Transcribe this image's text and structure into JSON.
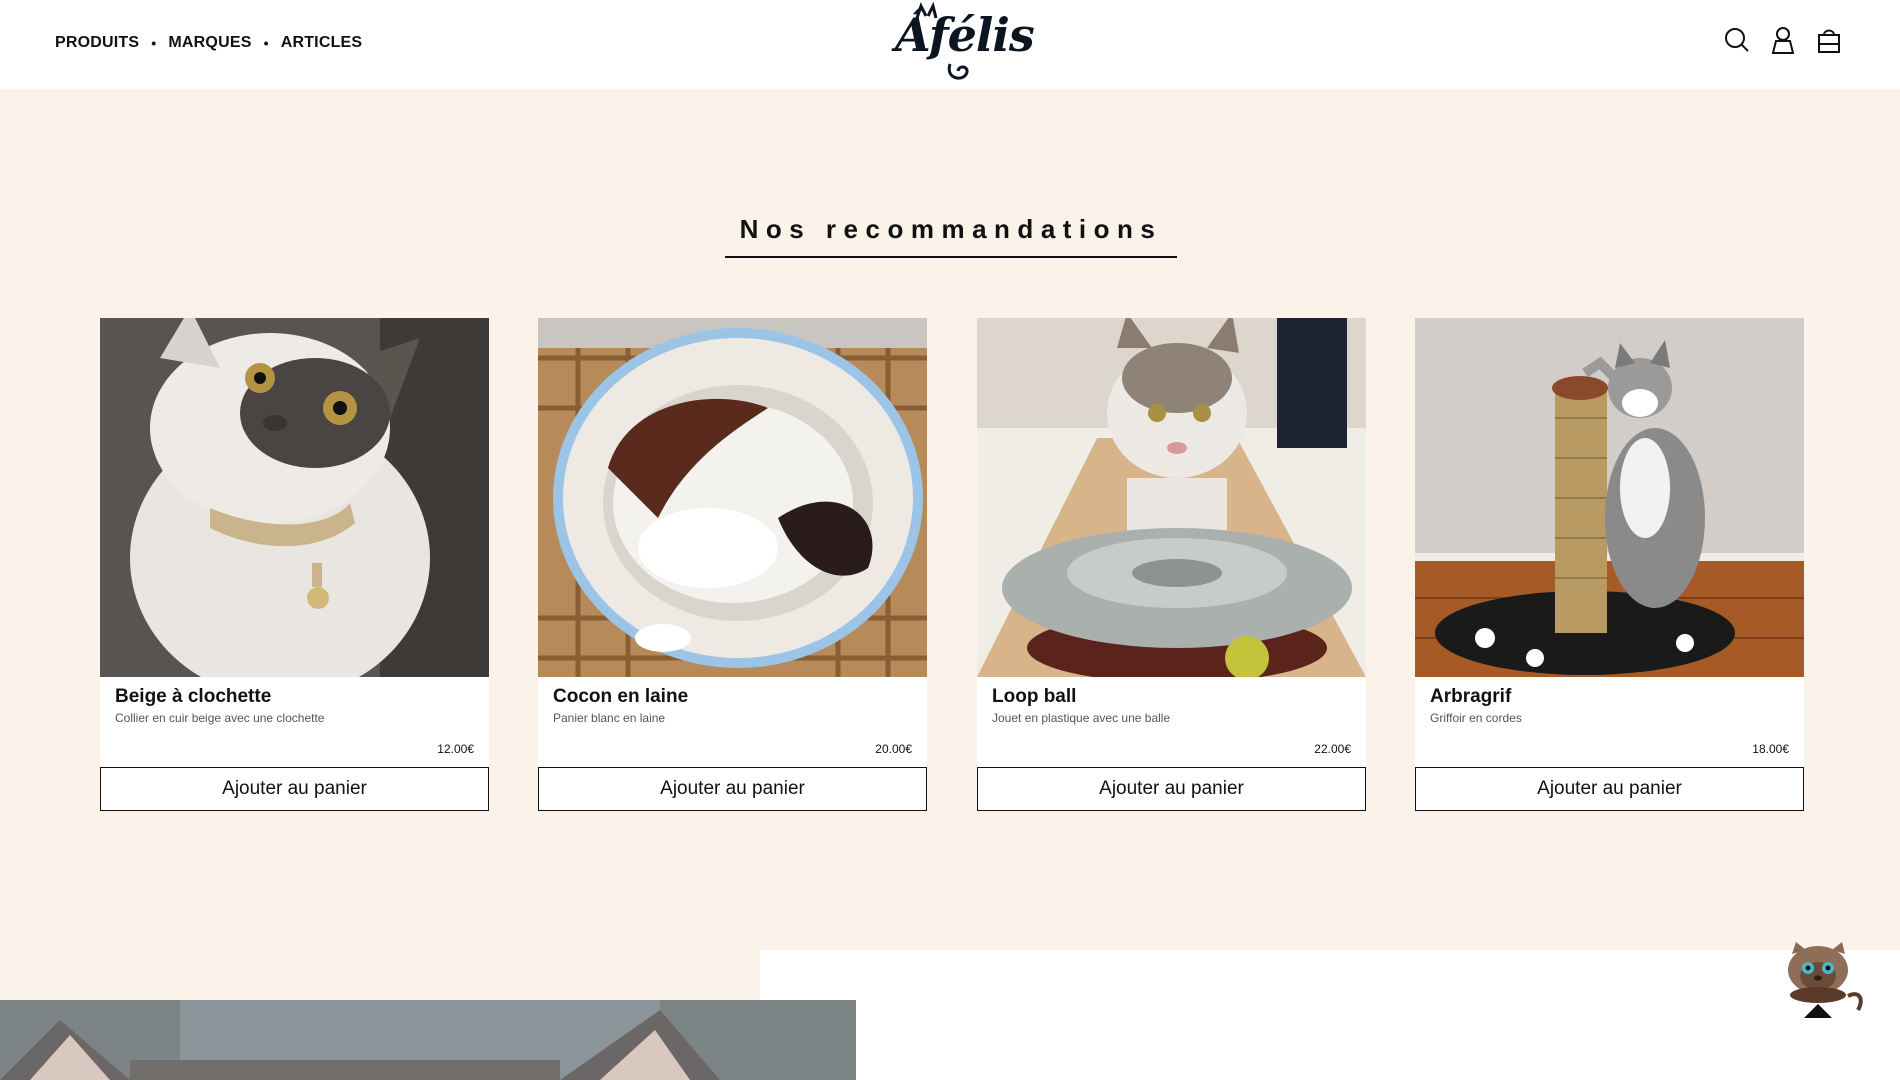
{
  "header": {
    "nav": [
      {
        "label": "PRODUITS"
      },
      {
        "label": "MARQUES"
      },
      {
        "label": "ARTICLES"
      }
    ],
    "nav_separator": "•",
    "logo_text": "Áfélis",
    "icons": [
      "search-icon",
      "user-icon",
      "cart-icon"
    ]
  },
  "recommendations": {
    "title": "Nos recommandations",
    "products": [
      {
        "name": "Beige à clochette",
        "description": "Collier en cuir beige avec une clochette",
        "price": "12.00€",
        "button": "Ajouter au panier"
      },
      {
        "name": "Cocon en laine",
        "description": "Panier blanc en laine",
        "price": "20.00€",
        "button": "Ajouter au panier"
      },
      {
        "name": "Loop ball",
        "description": "Jouet en plastique avec une balle",
        "price": "22.00€",
        "button": "Ajouter au panier"
      },
      {
        "name": "Arbragrif",
        "description": "Griffoir en cordes",
        "price": "18.00€",
        "button": "Ajouter au panier"
      }
    ]
  },
  "colors": {
    "background": "#fbf2ea",
    "header_bg": "#ffffff",
    "text": "#111111",
    "logo": "#0c1422"
  },
  "scroll_top_icon": "cat-scroll-to-top-icon"
}
